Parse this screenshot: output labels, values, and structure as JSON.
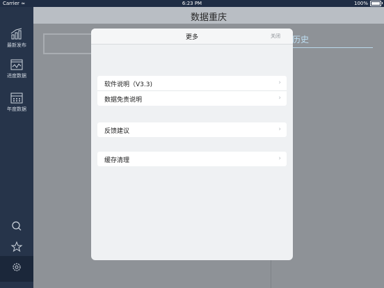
{
  "status_bar": {
    "carrier": "Carrier",
    "time": "6:23 PM",
    "battery": "100%"
  },
  "sidebar": {
    "items": [
      {
        "label": "最新发布",
        "icon": "bar-chart-icon"
      },
      {
        "label": "进度数据",
        "icon": "calendar-wave-icon"
      },
      {
        "label": "年度数据",
        "icon": "calendar-grid-icon"
      },
      {
        "label": "",
        "icon": "search-icon"
      },
      {
        "label": "",
        "icon": "star-icon"
      },
      {
        "label": "",
        "icon": "gear-icon"
      }
    ]
  },
  "header": {
    "title": "数据重庆"
  },
  "background": {
    "history_label": "历史"
  },
  "modal": {
    "title": "更多",
    "close_label": "关闭",
    "groups": [
      [
        {
          "label": "软件说明（V3.3)"
        },
        {
          "label": "数据免责说明"
        }
      ],
      [
        {
          "label": "反馈建议"
        }
      ],
      [
        {
          "label": "缓存清理"
        }
      ]
    ]
  },
  "colors": {
    "sidebar_bg": "#26344a",
    "accent_blue": "#bfe0f4"
  }
}
